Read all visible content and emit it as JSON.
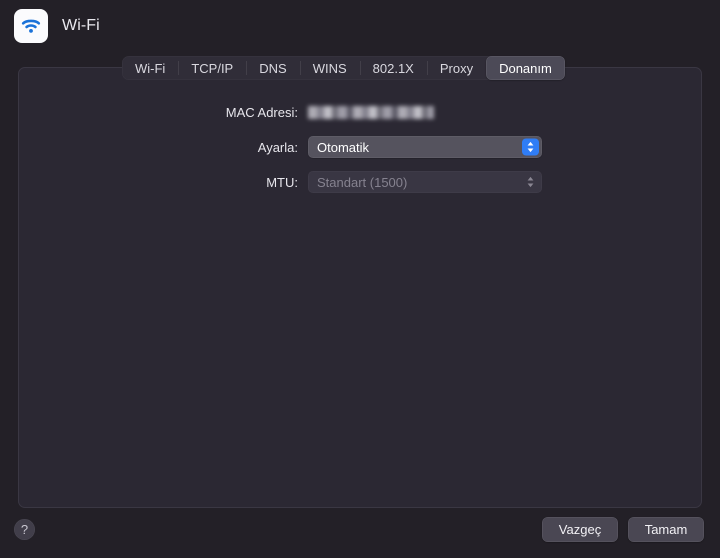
{
  "window": {
    "title": "Wi-Fi",
    "app_icon": "wifi-icon"
  },
  "tabs": [
    {
      "label": "Wi-Fi",
      "selected": false
    },
    {
      "label": "TCP/IP",
      "selected": false
    },
    {
      "label": "DNS",
      "selected": false
    },
    {
      "label": "WINS",
      "selected": false
    },
    {
      "label": "802.1X",
      "selected": false
    },
    {
      "label": "Proxy",
      "selected": false
    },
    {
      "label": "Donanım",
      "selected": true
    }
  ],
  "form": {
    "mac_address": {
      "label": "MAC Adresi:",
      "value": "",
      "redacted": true
    },
    "configure": {
      "label": "Ayarla:",
      "value": "Otomatik",
      "enabled": true
    },
    "mtu": {
      "label": "MTU:",
      "value": "Standart (1500)",
      "enabled": false
    }
  },
  "footer": {
    "help_label": "?",
    "cancel_label": "Vazgeç",
    "ok_label": "Tamam"
  },
  "colors": {
    "window_background": "#232027",
    "panel_background": "#2b2833",
    "accent": "#2f7df6",
    "selected_tab": "#4c4a57",
    "icon_blue": "#1b72d8"
  }
}
